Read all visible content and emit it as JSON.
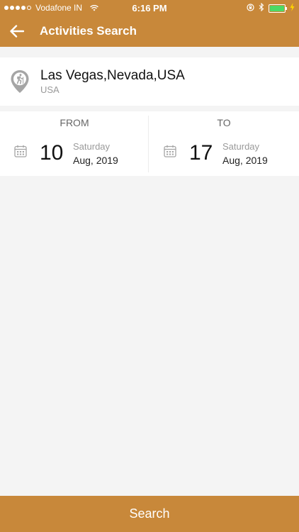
{
  "status_bar": {
    "carrier": "Vodafone IN",
    "time": "6:16 PM",
    "battery_level": 0.9
  },
  "nav": {
    "title": "Activities Search",
    "back_icon": "arrow-left-icon"
  },
  "location": {
    "icon": "hiker-pin-icon",
    "city": "Las Vegas,Nevada,USA",
    "country": "USA"
  },
  "dates": {
    "from": {
      "label": "FROM",
      "day": "10",
      "weekday": "Saturday",
      "month_year": "Aug, 2019"
    },
    "to": {
      "label": "TO",
      "day": "17",
      "weekday": "Saturday",
      "month_year": "Aug, 2019"
    }
  },
  "search_button": {
    "label": "Search"
  },
  "colors": {
    "accent": "#c8883a",
    "background": "#f4f4f4",
    "card": "#ffffff",
    "muted_text": "#9a9a9a"
  }
}
